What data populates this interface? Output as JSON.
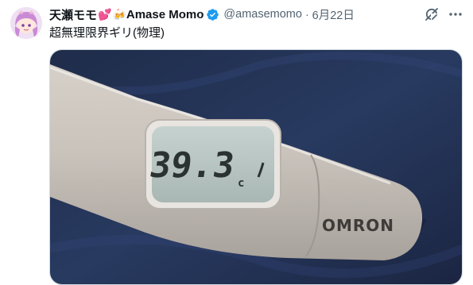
{
  "tweet": {
    "display_name": "天瀬モモ",
    "name_emoji_1": "💕",
    "name_emoji_2": "🍻",
    "name_suffix": "Amase Momo",
    "handle": "@amasemomo",
    "separator": "·",
    "date": "6月22日",
    "text": "超無理限界ギリ(物理)",
    "icons": {
      "verified": "verified-badge-icon",
      "grok": "grok-icon",
      "more": "more-options-icon"
    },
    "colors": {
      "verified": "#1d9bf0",
      "secondary_text": "#536471"
    }
  },
  "media": {
    "thermometer_reading": "39.3",
    "thermometer_unit": "c",
    "brand": "OMRON"
  }
}
